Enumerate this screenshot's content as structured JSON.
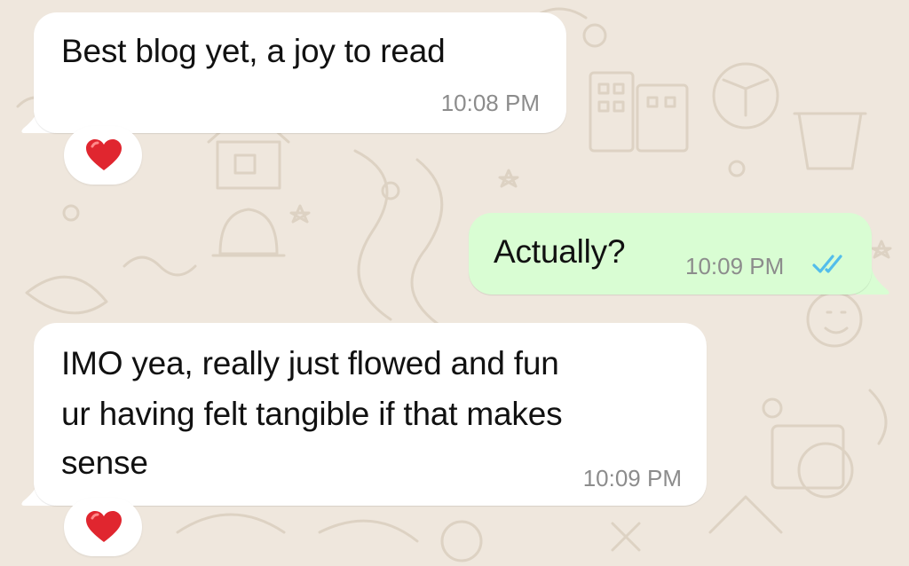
{
  "messages": [
    {
      "direction": "incoming",
      "text": "Best blog yet, a joy to read",
      "time": "10:08 PM",
      "reaction": "heart-emoji"
    },
    {
      "direction": "outgoing",
      "text": "Actually?",
      "time": "10:09 PM",
      "status": "read",
      "status_icon": "double-check-icon"
    },
    {
      "direction": "incoming",
      "text_lines": [
        "IMO yea, really just flowed and fun",
        "ur having felt tangible if that makes",
        "sense"
      ],
      "time": "10:09 PM",
      "reaction": "heart-emoji"
    }
  ],
  "colors": {
    "wallpaper": "#efe7dd",
    "incoming_bubble": "#ffffff",
    "outgoing_bubble": "#d9fdd3",
    "timestamp": "#8c8c8c",
    "read_ticks": "#53bdeb",
    "heart": "#e0262f"
  }
}
